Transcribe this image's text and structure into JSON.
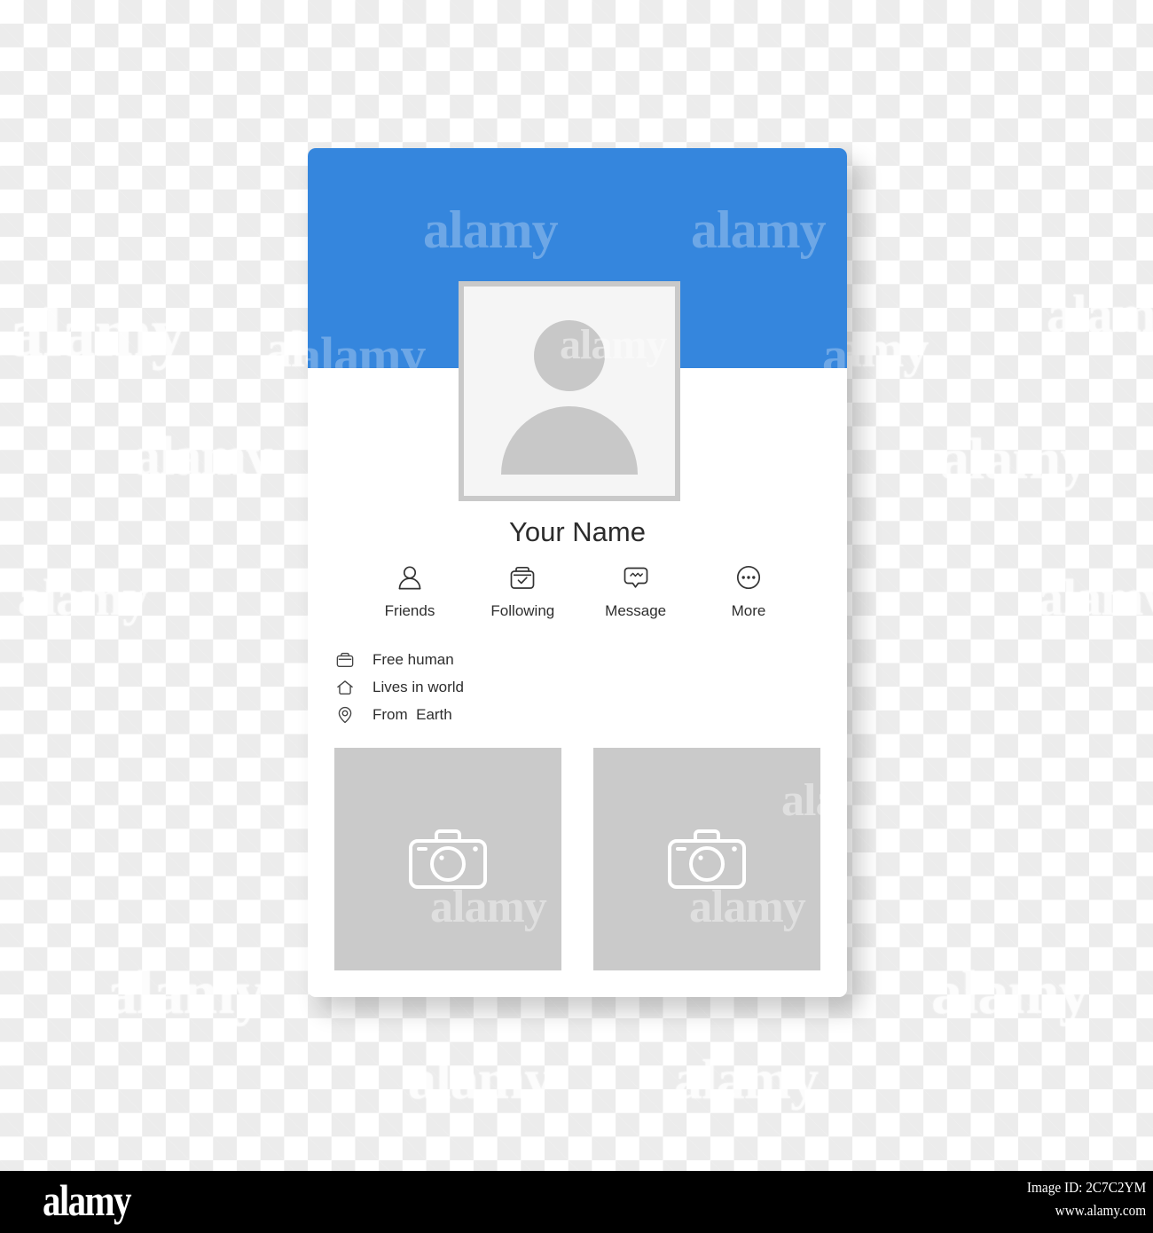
{
  "card": {
    "cover": {
      "name": "cover-banner",
      "color": "#3586dd"
    },
    "avatar": {
      "alt": "default-user-avatar"
    },
    "profile_name": "Your Name",
    "actions": [
      {
        "icon": "person-icon",
        "label": "Friends"
      },
      {
        "icon": "briefcase-check-icon",
        "label": "Following"
      },
      {
        "icon": "message-bubble-icon",
        "label": "Message"
      },
      {
        "icon": "more-dots-icon",
        "label": "More"
      }
    ],
    "info": [
      {
        "icon": "briefcase-icon",
        "text": "Free human"
      },
      {
        "icon": "home-icon",
        "text": "Lives in world"
      },
      {
        "icon": "location-pin-icon",
        "text": "From  Earth"
      }
    ],
    "photos": [
      {
        "icon": "camera-icon",
        "alt": "photo-placeholder-1"
      },
      {
        "icon": "camera-icon",
        "alt": "photo-placeholder-2"
      }
    ]
  },
  "footer": {
    "logo": "alamy",
    "image_id": "Image ID: 2C7C2YM",
    "website": "www.alamy.com"
  },
  "watermark": {
    "text": "alamy"
  },
  "colors": {
    "accent_blue": "#3586dd",
    "placeholder_gray": "#cacaca",
    "avatar_gray": "#c8c8c8",
    "text_dark": "#2c2c2c",
    "footer_bg": "#000000"
  }
}
